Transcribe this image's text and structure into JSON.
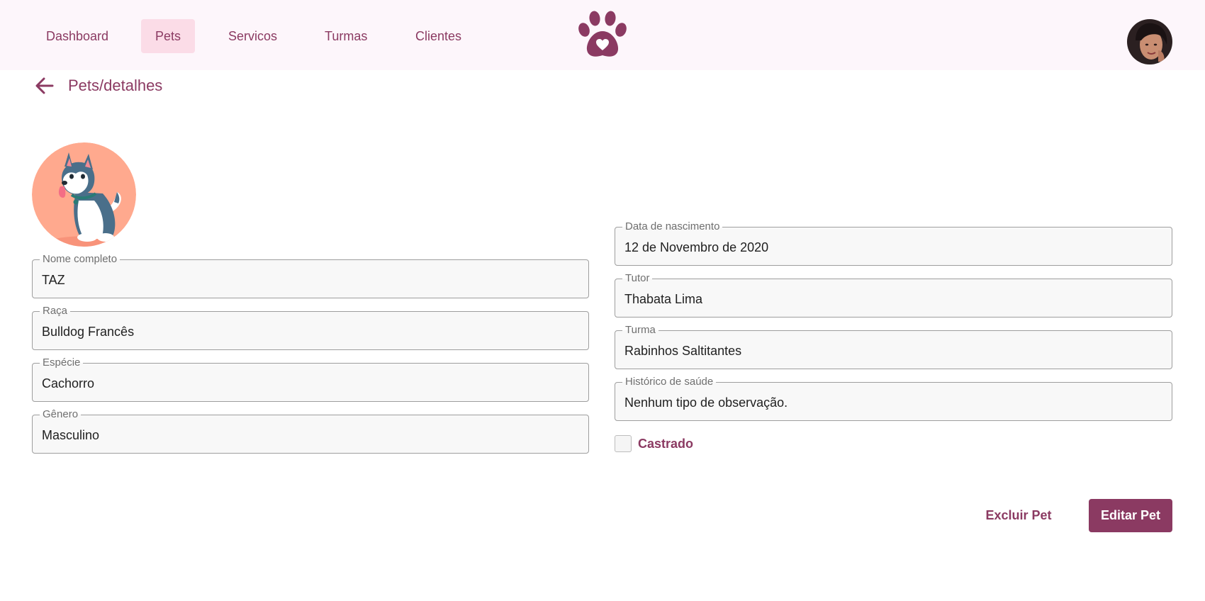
{
  "nav": {
    "items": [
      {
        "label": "Dashboard",
        "active": false
      },
      {
        "label": "Pets",
        "active": true
      },
      {
        "label": "Servicos",
        "active": false
      },
      {
        "label": "Turmas",
        "active": false
      },
      {
        "label": "Clientes",
        "active": false
      }
    ],
    "logo_icon": "paw-heart-icon",
    "avatar_icon": "user-avatar"
  },
  "header": {
    "back_icon": "arrow-left-icon",
    "breadcrumb": "Pets/detalhes"
  },
  "pet": {
    "photo_icon": "husky-dog-illustration",
    "fields_left": [
      {
        "label": "Nome completo",
        "value": "TAZ"
      },
      {
        "label": "Raça",
        "value": "Bulldog Francês"
      },
      {
        "label": "Espécie",
        "value": "Cachorro"
      },
      {
        "label": "Gênero",
        "value": "Masculino"
      }
    ],
    "fields_right": [
      {
        "label": "Data de nascimento",
        "value": "12 de Novembro de 2020"
      },
      {
        "label": "Tutor",
        "value": "Thabata Lima"
      },
      {
        "label": "Turma",
        "value": "Rabinhos Saltitantes"
      },
      {
        "label": "Histórico de saúde",
        "value": "Nenhum tipo de observação."
      }
    ],
    "castrado": {
      "label": "Castrado",
      "checked": false
    }
  },
  "actions": {
    "delete_label": "Excluir Pet",
    "edit_label": "Editar Pet"
  },
  "colors": {
    "primary": "#8b3a62",
    "nav_bg": "#fdf6fb",
    "nav_active": "#fbdce7",
    "photo_bg": "#ffa98e"
  }
}
